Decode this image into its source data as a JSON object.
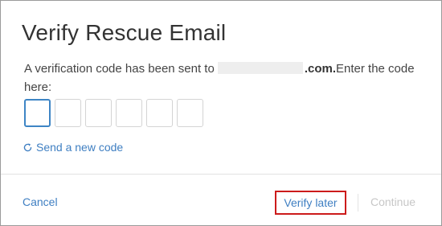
{
  "dialog": {
    "title": "Verify Rescue Email",
    "message_prefix": "A verification code has been sent to",
    "email_domain": ".com.",
    "message_suffix": "Enter the code here:",
    "code_digits": [
      "",
      "",
      "",
      "",
      "",
      ""
    ],
    "resend_label": "Send a new code",
    "resend_icon": "refresh-icon"
  },
  "footer": {
    "cancel_label": "Cancel",
    "verify_later_label": "Verify later",
    "continue_label": "Continue"
  },
  "colors": {
    "link": "#3f7fc2",
    "highlight_border": "#cc1b1b",
    "active_input_border": "#3e85c5",
    "disabled_text": "#c7c7c7"
  }
}
